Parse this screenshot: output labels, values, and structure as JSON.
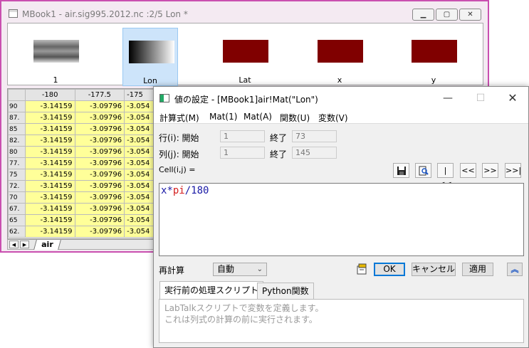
{
  "mbook": {
    "title": "MBook1 - air.sig995.2012.nc :2/5 Lon *",
    "thumbnails": [
      {
        "label": "1",
        "kind": "map"
      },
      {
        "label": "Lon",
        "kind": "gradient",
        "selected": true
      },
      {
        "label": "Lat",
        "kind": "solid"
      },
      {
        "label": "x",
        "kind": "solid"
      },
      {
        "label": "y",
        "kind": "solid"
      }
    ],
    "thumb_solid_color": "#800000",
    "grid": {
      "columns": [
        "-180",
        "-177.5",
        "-175"
      ],
      "rows": [
        {
          "h": "90",
          "v": [
            "-3.14159",
            "-3.09796",
            "-3.054"
          ]
        },
        {
          "h": "87.",
          "v": [
            "-3.14159",
            "-3.09796",
            "-3.054"
          ]
        },
        {
          "h": "85",
          "v": [
            "-3.14159",
            "-3.09796",
            "-3.054"
          ]
        },
        {
          "h": "82.",
          "v": [
            "-3.14159",
            "-3.09796",
            "-3.054"
          ]
        },
        {
          "h": "80",
          "v": [
            "-3.14159",
            "-3.09796",
            "-3.054"
          ]
        },
        {
          "h": "77.",
          "v": [
            "-3.14159",
            "-3.09796",
            "-3.054"
          ]
        },
        {
          "h": "75",
          "v": [
            "-3.14159",
            "-3.09796",
            "-3.054"
          ]
        },
        {
          "h": "72.",
          "v": [
            "-3.14159",
            "-3.09796",
            "-3.054"
          ]
        },
        {
          "h": "70",
          "v": [
            "-3.14159",
            "-3.09796",
            "-3.054"
          ]
        },
        {
          "h": "67.",
          "v": [
            "-3.14159",
            "-3.09796",
            "-3.054"
          ]
        },
        {
          "h": "65",
          "v": [
            "-3.14159",
            "-3.09796",
            "-3.054"
          ]
        },
        {
          "h": "62.",
          "v": [
            "-3.14159",
            "-3.09796",
            "-3.054"
          ]
        }
      ]
    },
    "sheet_tab": "air",
    "cell_color": "#ffff99"
  },
  "dialog": {
    "title": "値の設定 - [MBook1]air!Mat(\"Lon\")",
    "menu": [
      "計算式(M)",
      "Mat(1)",
      "Mat(A)",
      "関数(U)",
      "変数(V)"
    ],
    "row_label": "行(i): 開始",
    "row_start": "1",
    "row_end_label": "終了",
    "row_end": "73",
    "col_label": "列(j): 開始",
    "col_start": "1",
    "col_end_label": "終了",
    "col_end": "145",
    "cell_label": "Cell(i,j) =",
    "nav_buttons": [
      "|<<",
      "<<",
      ">>",
      ">>|"
    ],
    "formula": {
      "var": "x",
      "op": "*",
      "kw": "pi",
      "rest": "/180"
    },
    "recalc_label": "再計算",
    "recalc_value": "自動",
    "ok": "OK",
    "cancel": "キャンセル",
    "apply": "適用",
    "tabs": [
      "実行前の処理スクリプト",
      "Python関数"
    ],
    "script_placeholder_1": "LabTalkスクリプトで変数を定義します。",
    "script_placeholder_2": "これは列式の計算の前に実行されます。"
  }
}
